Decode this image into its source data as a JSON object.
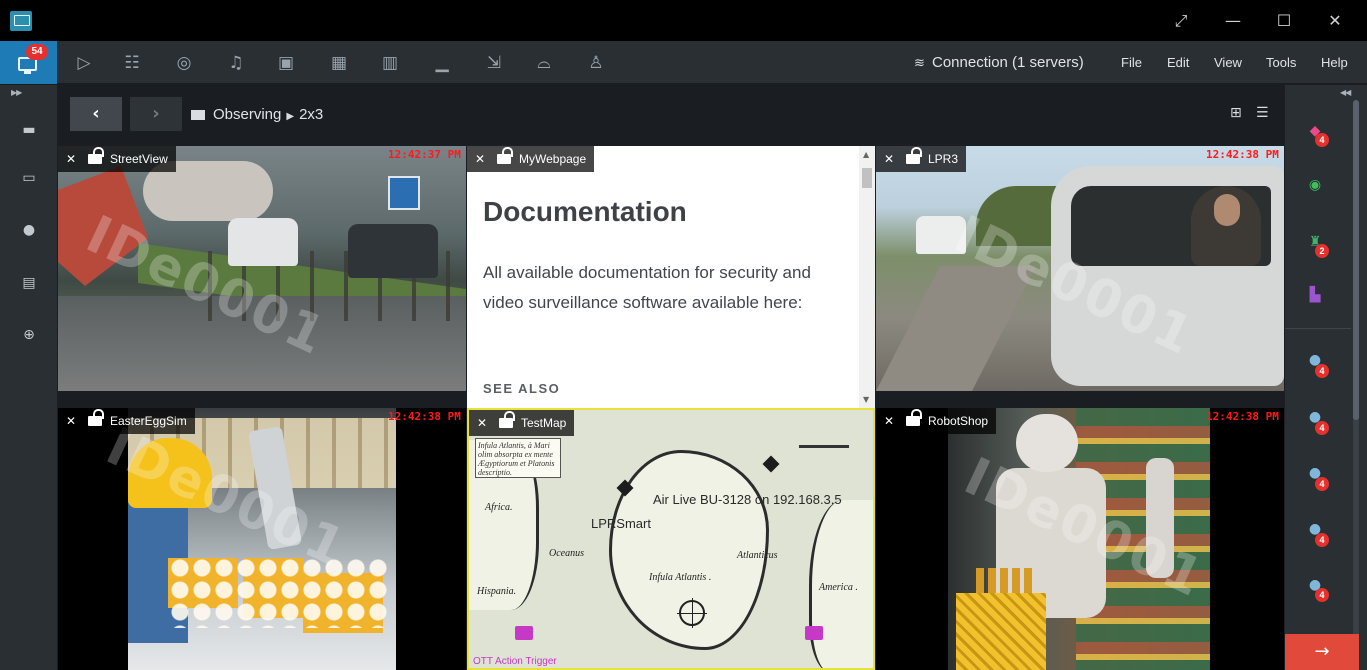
{
  "titlebar": {
    "logo_icon": "monitor-icon",
    "controls": [
      "restore-icon",
      "minimize-icon",
      "maximize-icon",
      "close-icon"
    ]
  },
  "toolbar": {
    "notifications_badge": "54",
    "tools": [
      "play-icon",
      "layouts-icon",
      "compass-icon",
      "bell-icon",
      "files-icon",
      "grid-icon",
      "videowall-icon",
      "chart-icon",
      "export-icon",
      "helmet-icon",
      "user-icon"
    ],
    "connection_label": "Connection (1 servers)",
    "menu": [
      "File",
      "Edit",
      "View",
      "Tools",
      "Help"
    ]
  },
  "breadcrumb": {
    "root": "Observing",
    "layout": "2x3"
  },
  "left_sidebar": {
    "items": [
      "cameras-icon",
      "devices-icon",
      "globe-icon",
      "monitor-cursor-icon",
      "web-icon"
    ]
  },
  "right_sidebar": {
    "items": [
      {
        "icon": "alarm-bell-icon",
        "badge": "4"
      },
      {
        "icon": "eye-icon",
        "badge": ""
      },
      {
        "icon": "objects-icon",
        "badge": "2"
      },
      {
        "icon": "door-icon",
        "badge": ""
      },
      {
        "icon": "pin-icon",
        "badge": "4"
      },
      {
        "icon": "pin-icon",
        "badge": "4"
      },
      {
        "icon": "pin-icon",
        "badge": "4"
      },
      {
        "icon": "pin-icon",
        "badge": "4"
      },
      {
        "icon": "pin-icon",
        "badge": "4"
      }
    ]
  },
  "tiles": {
    "street": {
      "title": "StreetView",
      "time": "12:42:37 PM"
    },
    "web": {
      "title": "MyWebpage",
      "heading": "Documentation",
      "body": "All available documentation for security and video surveillance software available here:",
      "see_also": "SEE ALSO"
    },
    "lpr": {
      "title": "LPR3",
      "time": "12:42:38 PM"
    },
    "egg": {
      "title": "EasterEggSim",
      "time": "12:42:38 PM"
    },
    "map": {
      "title": "TestMap",
      "overlay1": "Air Live BU-3128 on 192.168.3.5",
      "overlay2": "LPRSmart",
      "note": "Infula Atlantis, à Mari olim absorpta ex mente Ægyptiorum et Platonis descriptio.",
      "labels": [
        "Africa.",
        "Oceanus",
        "Infula Atlantis .",
        "America .",
        "Atlanticus",
        "Hispania."
      ],
      "bottom_label": "OTT Action Trigger"
    },
    "robot": {
      "title": "RobotShop",
      "time": "12:42:38 PM"
    }
  },
  "watermark": "IDe0001",
  "colors": {
    "accent": "#1e7bb5",
    "badge": "#e5302d",
    "timestamp": "#ff1a1a",
    "selected_border": "#e7e23a",
    "action_button": "#e14a3b"
  }
}
